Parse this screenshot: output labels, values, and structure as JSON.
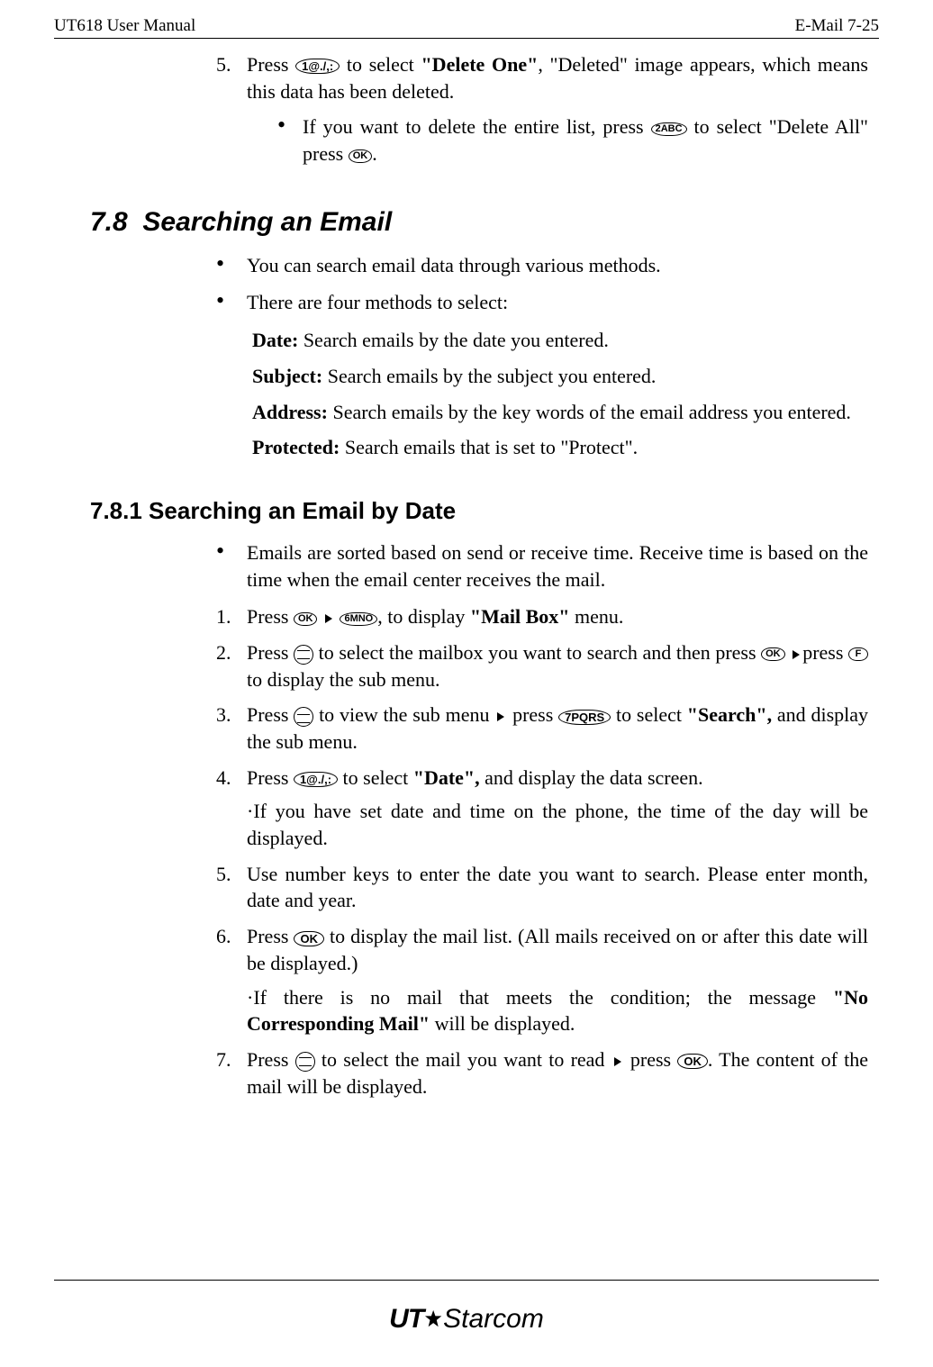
{
  "header": {
    "left": "UT618 User Manual",
    "right": "E-Mail   7-25"
  },
  "top_continuation": {
    "item5_num": "5.",
    "item5_a": "Press ",
    "item5_b": " to select ",
    "item5_bold": "\"Delete One\"",
    "item5_c": ", \"Deleted\" image appears, which means this data has been deleted.",
    "sub_a": "If you want to delete the entire list, press ",
    "sub_b": " to select \"Delete All\" press ",
    "sub_c": "."
  },
  "buttons": {
    "one": "1@./,:",
    "two": "2ABC",
    "six": "6MNO",
    "seven": "7PQRS",
    "ok": "OK",
    "f": "F"
  },
  "section78": {
    "num": "7.8",
    "title": "Searching an Email",
    "bullet1": "You can search email data through various methods.",
    "bullet2": "There are four methods to select:",
    "date_label": "Date:",
    "date_text": " Search emails by the date you entered.",
    "subject_label": "Subject:",
    "subject_text": " Search emails by the subject you entered.",
    "address_label": "Address:",
    "address_text": " Search emails by the key words of the email address you entered.",
    "protected_label": "Protected:",
    "protected_text": " Search emails that is set to \"Protect\"."
  },
  "section781": {
    "title": "7.8.1 Searching an Email by Date",
    "bullet1": "Emails are sorted based on send or receive time. Receive time is based on the time when the email center receives the mail.",
    "s1_num": "1.",
    "s1_a": "Press ",
    "s1_b": ", to display ",
    "s1_bold": "\"Mail Box\"",
    "s1_c": " menu.",
    "s2_num": "2.",
    "s2_a": "Press ",
    "s2_b": " to select the mailbox you want to search and then press ",
    "s2_c": "press ",
    "s2_d": " to display the sub menu.",
    "s3_num": "3.",
    "s3_a": "Press ",
    "s3_b": " to view the sub menu ",
    "s3_c": " press ",
    "s3_d": " to select ",
    "s3_bold": "\"Search\",",
    "s3_e": " and display the sub menu.",
    "s4_num": "4.",
    "s4_a": "Press ",
    "s4_b": " to select ",
    "s4_bold": "\"Date\",",
    "s4_c": " and display the data screen.",
    "s4_note": "·If you have set date and time on the phone, the time of the day will be displayed.",
    "s5_num": "5.",
    "s5": "Use number keys to enter the date you want to search. Please enter month, date and year.",
    "s6_num": "6.",
    "s6_a": "Press ",
    "s6_b": " to display the mail list. (All mails received on or after this date will be displayed.)",
    "s6_note_a": "·If there is no mail that meets the condition; the message ",
    "s6_note_bold": "\"No Corresponding Mail\"",
    "s6_note_b": " will be displayed.",
    "s7_num": "7.",
    "s7_a": "Press ",
    "s7_b": " to select the mail you want to read ",
    "s7_c": " press ",
    "s7_d": ". The content of the mail will be displayed."
  },
  "footer": {
    "brand_ut": "UT",
    "brand_star": "Starcom"
  }
}
